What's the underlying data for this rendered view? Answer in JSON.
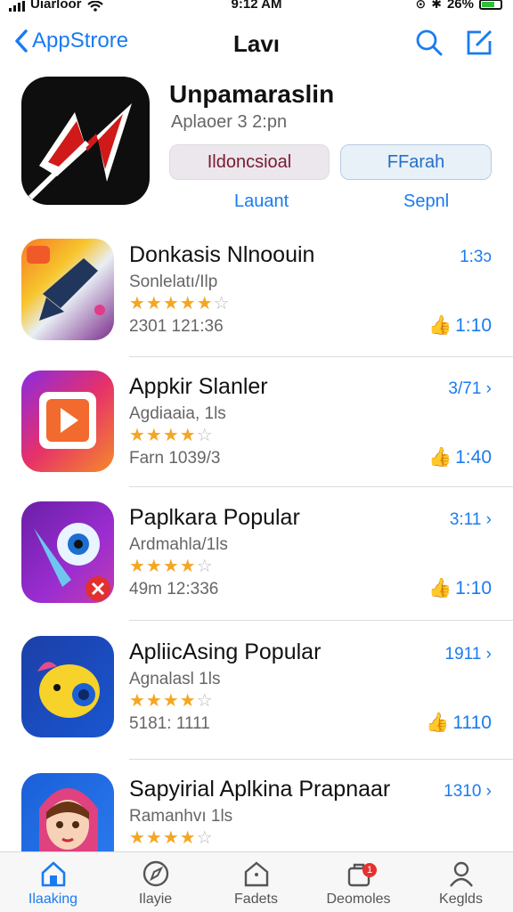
{
  "status_bar": {
    "carrier": "Uiarloor",
    "time": "9:12 AM",
    "battery": "26%"
  },
  "nav": {
    "back_label": "AppStrore",
    "title": "Lavı"
  },
  "featured": {
    "title": "Unpamaraslin",
    "subtitle": "Aplaoer 3 2:pn",
    "get_label": "Ildoncsioal",
    "share_label": "FFarah",
    "link_left": "Lauant",
    "link_right": "Sepnl"
  },
  "apps": [
    {
      "name": "Donkasis Nlnoouin",
      "category": "Sonlelatı/Ilp",
      "rating": 5,
      "meta": "2301 121:36",
      "count": "1:3ɔ",
      "downloads": "1:10"
    },
    {
      "name": "Appkir Slanler",
      "category": "Agdiaaia, 1ls",
      "rating": 4,
      "meta": "Farn 1039/3",
      "count": "3/71 ›",
      "downloads": "1:40"
    },
    {
      "name": "Paplkara Popular",
      "category": "Ardmahla/1ls",
      "rating": 4,
      "meta": "49m 12:336",
      "count": "3:11 ›",
      "downloads": "1:10"
    },
    {
      "name": "ApliicAsing Popular",
      "category": "Agnalasl 1ls",
      "rating": 4,
      "meta": "5181: 1111",
      "count": "1911 ›",
      "downloads": "1110"
    },
    {
      "name": "Sapyirial Aplkina Prapnaar",
      "category": "Ramanhvı 1ls",
      "rating": 4,
      "meta": "",
      "count": "1310 ›",
      "downloads": ""
    }
  ],
  "tabs": [
    {
      "label": "Ilaaking",
      "icon": "house-icon"
    },
    {
      "label": "Ilayie",
      "icon": "compass-icon"
    },
    {
      "label": "Fadets",
      "icon": "bookmark-icon"
    },
    {
      "label": "Deomoles",
      "icon": "gift-icon",
      "badge": "1"
    },
    {
      "label": "Keglds",
      "icon": "person-icon"
    }
  ],
  "colors": {
    "accent": "#1a7bf0",
    "star": "#f4a623",
    "get_text": "#7b1930"
  }
}
